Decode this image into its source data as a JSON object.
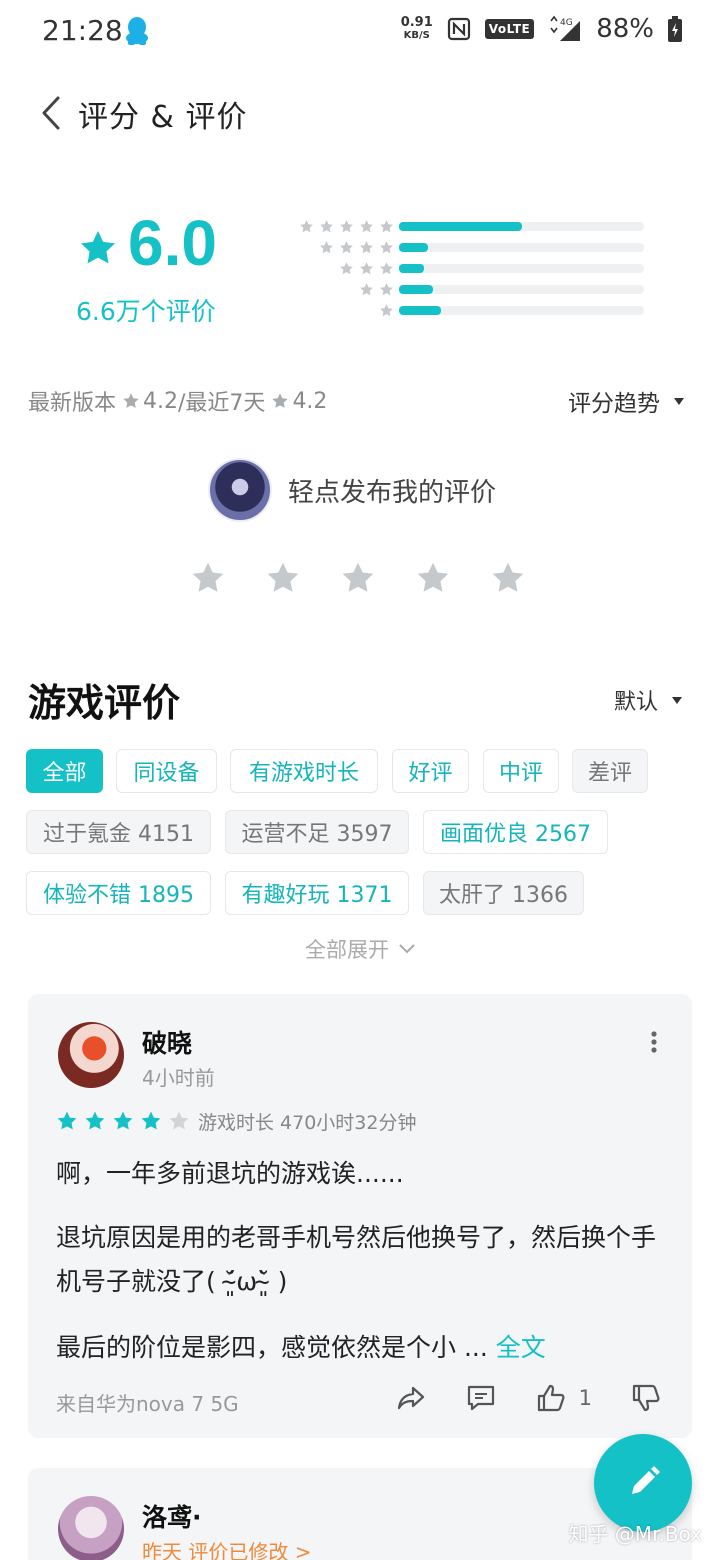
{
  "status_bar": {
    "time": "21:28",
    "net_speed_value": "0.91",
    "net_speed_unit": "KB/S",
    "volte": "VoLTE",
    "network": "4G",
    "battery": "88%"
  },
  "header": {
    "title": "评分 & 评价"
  },
  "rating": {
    "score": "6.0",
    "count_text": "6.6万个评价",
    "distribution": [
      {
        "stars": 5,
        "fraction": 0.5
      },
      {
        "stars": 4,
        "fraction": 0.12
      },
      {
        "stars": 3,
        "fraction": 0.1
      },
      {
        "stars": 2,
        "fraction": 0.14
      },
      {
        "stars": 1,
        "fraction": 0.17
      }
    ],
    "latest_version_label": "最新版本",
    "latest_version_score": "4.2",
    "recent_label": "/最近7天",
    "recent_score": "4.2",
    "trend_label": "评分趋势"
  },
  "my_review": {
    "prompt": "轻点发布我的评价"
  },
  "reviews_section": {
    "title": "游戏评价",
    "sort_label": "默认",
    "filters": [
      "全部",
      "同设备",
      "有游戏时长",
      "好评",
      "中评",
      "差评"
    ],
    "tags": [
      "过于氪金 4151",
      "运营不足 3597",
      "画面优良 2567",
      "体验不错 1895",
      "有趣好玩 1371",
      "太肝了 1366"
    ],
    "expand_label": "全部展开"
  },
  "review_1": {
    "name": "破晓",
    "time": "4小时前",
    "stars": 4,
    "playtime": "游戏时长 470小时32分钟",
    "p1": "啊，一年多前退坑的游戏诶......",
    "p2": "退坑原因是用的老哥手机号然后他换号了，然后换个手机号子就没了( ˘̴͈́ω˘̴͈̀ )",
    "p3": "最后的阶位是影四，感觉依然是个小 ...",
    "full_text": "全文",
    "device": "来自华为nova 7 5G",
    "likes": "1"
  },
  "review_2": {
    "name": "洛鸢·",
    "time": "昨天  评价已修改 >"
  },
  "watermark": "知乎 @Mr.Box",
  "colors": {
    "accent": "#14c1c7",
    "star_gray": "#c6c9cc",
    "card_bg": "#f3f5f7"
  }
}
